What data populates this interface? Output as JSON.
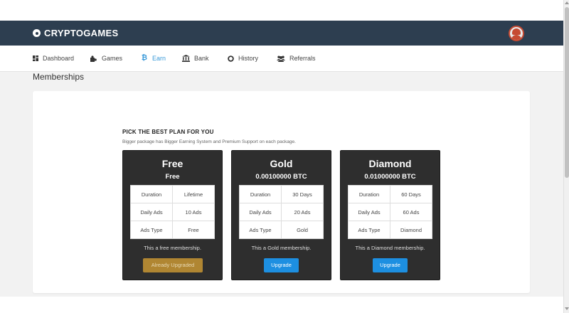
{
  "header": {
    "brand": "CRYPTOGAMES"
  },
  "nav": {
    "items": [
      {
        "label": "Dashboard",
        "icon": "dashboard-icon"
      },
      {
        "label": "Games",
        "icon": "puzzle-icon"
      },
      {
        "label": "Earn",
        "icon": "bitcoin-icon",
        "active": true
      },
      {
        "label": "Bank",
        "icon": "bank-icon"
      },
      {
        "label": "History",
        "icon": "history-icon"
      },
      {
        "label": "Referrals",
        "icon": "users-icon"
      }
    ]
  },
  "page": {
    "title": "Memberships"
  },
  "section": {
    "title": "PICK THE BEST PLAN FOR YOU",
    "subtitle": "Bigger package has Bigger Earning System and Premium Support on each package."
  },
  "plans": [
    {
      "name": "Free",
      "price": "Free",
      "rows": [
        [
          "Duration",
          "Lifetime"
        ],
        [
          "Daily Ads",
          "10 Ads"
        ],
        [
          "Ads Type",
          "Free"
        ]
      ],
      "description": "This a free membership.",
      "button": "Already Upgraded"
    },
    {
      "name": "Gold",
      "price": "0.00100000 BTC",
      "rows": [
        [
          "Duration",
          "30 Days"
        ],
        [
          "Daily Ads",
          "20 Ads"
        ],
        [
          "Ads Type",
          "Gold"
        ]
      ],
      "description": "This a Gold membership.",
      "button": "Upgrade"
    },
    {
      "name": "Diamond",
      "price": "0.01000000 BTC",
      "rows": [
        [
          "Duration",
          "60 Days"
        ],
        [
          "Daily Ads",
          "60 Ads"
        ],
        [
          "Ads Type",
          "Diamond"
        ]
      ],
      "description": "This a Diamond membership.",
      "button": "Upgrade"
    }
  ],
  "colors": {
    "header_bg": "#2d3e50",
    "accent": "#3a9ad9",
    "upgrade_button": "#1d8fe1",
    "upgraded_button": "#b08632",
    "card_bg": "#2e2e2e"
  }
}
